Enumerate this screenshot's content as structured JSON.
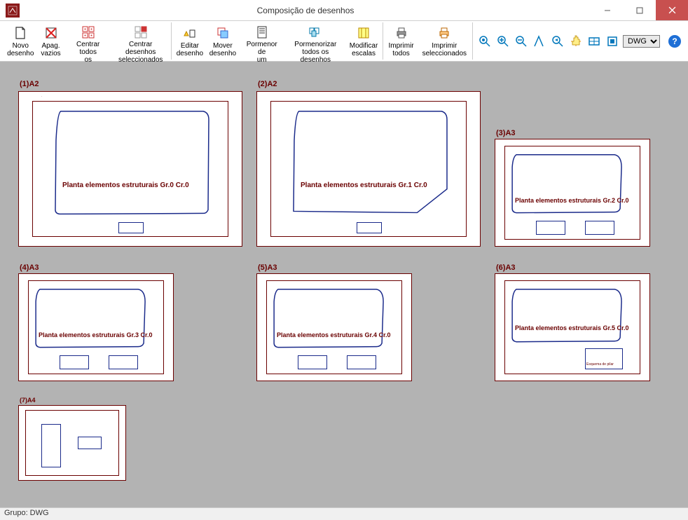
{
  "titlebar": {
    "title": "Composição de desenhos"
  },
  "toolbar": {
    "novo": "Novo\ndesenho",
    "apagar": "Apag.\nvazios",
    "centrar_todos": "Centrar todos\nos desenhos",
    "centrar_sel": "Centrar desenhos\nseleccionados",
    "editar": "Editar\ndesenho",
    "mover": "Mover\ndesenho",
    "pormenor_um": "Pormenor de\num desenho",
    "pormenor_todos": "Pormenorizar\ntodos os desenhos",
    "modificar": "Modificar\nescalas",
    "imprimir_todos": "Imprimir\ntodos",
    "imprimir_sel": "Imprimir\nseleccionados"
  },
  "format": {
    "selected": "DWG"
  },
  "sheets": [
    {
      "id": "(1)A2",
      "caption": "Planta elementos estruturais Gr.0 Cr.0"
    },
    {
      "id": "(2)A2",
      "caption": "Planta elementos estruturais Gr.1 Cr.0"
    },
    {
      "id": "(3)A3",
      "caption": "Planta elementos estruturais Gr.2 Cr.0"
    },
    {
      "id": "(4)A3",
      "caption": "Planta elementos estruturais Gr.3 Cr.0"
    },
    {
      "id": "(5)A3",
      "caption": "Planta elementos estruturais Gr.4 Cr.0"
    },
    {
      "id": "(6)A3",
      "caption": "Planta elementos estruturais Gr.5 Cr.0"
    },
    {
      "id": "(7)A4",
      "caption": ""
    }
  ],
  "esquema": "Esquema de pilar",
  "statusbar": {
    "grupo": "Grupo: DWG"
  }
}
